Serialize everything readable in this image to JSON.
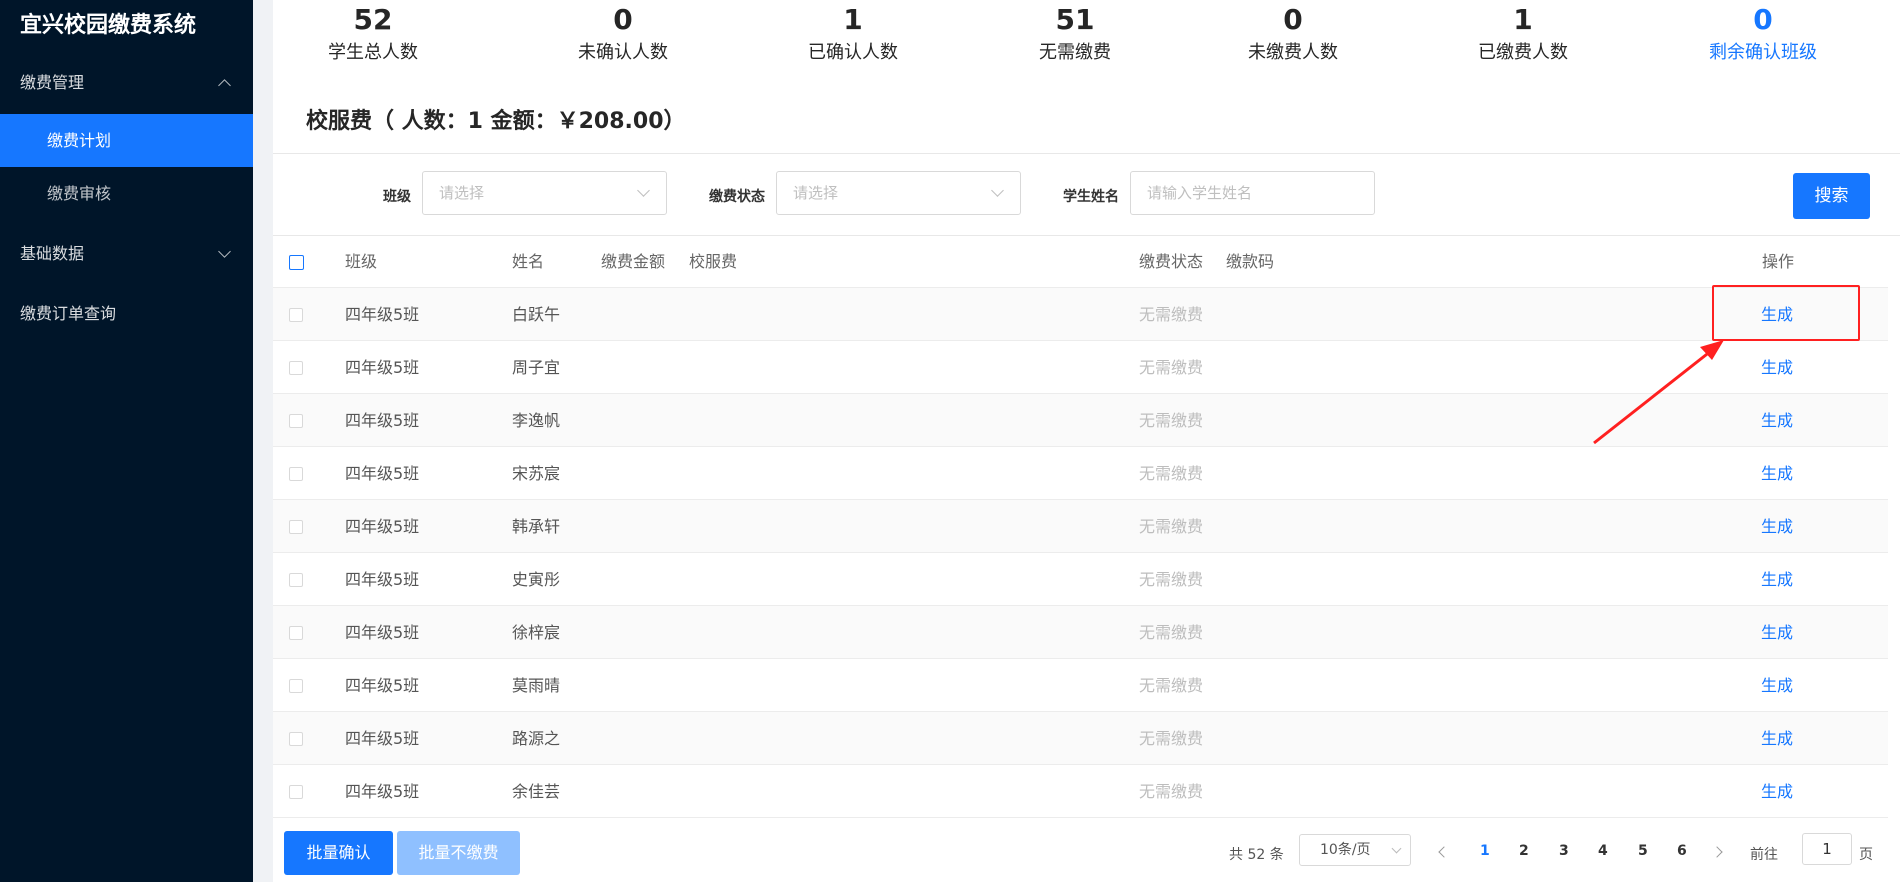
{
  "app": {
    "title": "宜兴校园缴费系统"
  },
  "sidebar": {
    "groups": [
      {
        "label": "缴费管理",
        "items": [
          "缴费计划",
          "缴费审核"
        ]
      },
      {
        "label": "基础数据"
      },
      {
        "label": "缴费订单查询"
      }
    ]
  },
  "stats": [
    {
      "value": "52",
      "label": "学生总人数"
    },
    {
      "value": "0",
      "label": "未确认人数"
    },
    {
      "value": "1",
      "label": "已确认人数"
    },
    {
      "value": "51",
      "label": "无需缴费"
    },
    {
      "value": "0",
      "label": "未缴费人数"
    },
    {
      "value": "1",
      "label": "已缴费人数"
    },
    {
      "value": "0",
      "label": "剩余确认班级"
    }
  ],
  "section": {
    "title": "校服费（ 人数：1 金额：￥208.00）"
  },
  "filters": {
    "class_label": "班级",
    "class_placeholder": "请选择",
    "status_label": "缴费状态",
    "status_placeholder": "请选择",
    "name_label": "学生姓名",
    "name_placeholder": "请输入学生姓名",
    "search_label": "搜索"
  },
  "table": {
    "headers": {
      "class": "班级",
      "name": "姓名",
      "amount": "缴费金额",
      "uniform": "校服费",
      "status": "缴费状态",
      "code": "缴款码",
      "action": "操作"
    },
    "rows": [
      {
        "class": "四年级5班",
        "name": "白跃午",
        "status": "无需缴费",
        "action": "生成"
      },
      {
        "class": "四年级5班",
        "name": "周子宜",
        "status": "无需缴费",
        "action": "生成"
      },
      {
        "class": "四年级5班",
        "name": "李逸帆",
        "status": "无需缴费",
        "action": "生成"
      },
      {
        "class": "四年级5班",
        "name": "宋苏宸",
        "status": "无需缴费",
        "action": "生成"
      },
      {
        "class": "四年级5班",
        "name": "韩承轩",
        "status": "无需缴费",
        "action": "生成"
      },
      {
        "class": "四年级5班",
        "name": "史寅彤",
        "status": "无需缴费",
        "action": "生成"
      },
      {
        "class": "四年级5班",
        "name": "徐梓宸",
        "status": "无需缴费",
        "action": "生成"
      },
      {
        "class": "四年级5班",
        "name": "莫雨晴",
        "status": "无需缴费",
        "action": "生成"
      },
      {
        "class": "四年级5班",
        "name": "路源之",
        "status": "无需缴费",
        "action": "生成"
      },
      {
        "class": "四年级5班",
        "name": "余佳芸",
        "status": "无需缴费",
        "action": "生成"
      }
    ]
  },
  "footer": {
    "batch_confirm": "批量确认",
    "batch_no_pay": "批量不缴费",
    "total": "共 52 条",
    "page_size": "10条/页",
    "pages": [
      "1",
      "2",
      "3",
      "4",
      "5",
      "6"
    ],
    "current_page": "1",
    "goto_prefix": "前往",
    "goto_value": "1",
    "goto_suffix": "页"
  },
  "colors": {
    "primary": "#1677ff",
    "sidebar": "#001529",
    "annotation": "#ff2020"
  }
}
